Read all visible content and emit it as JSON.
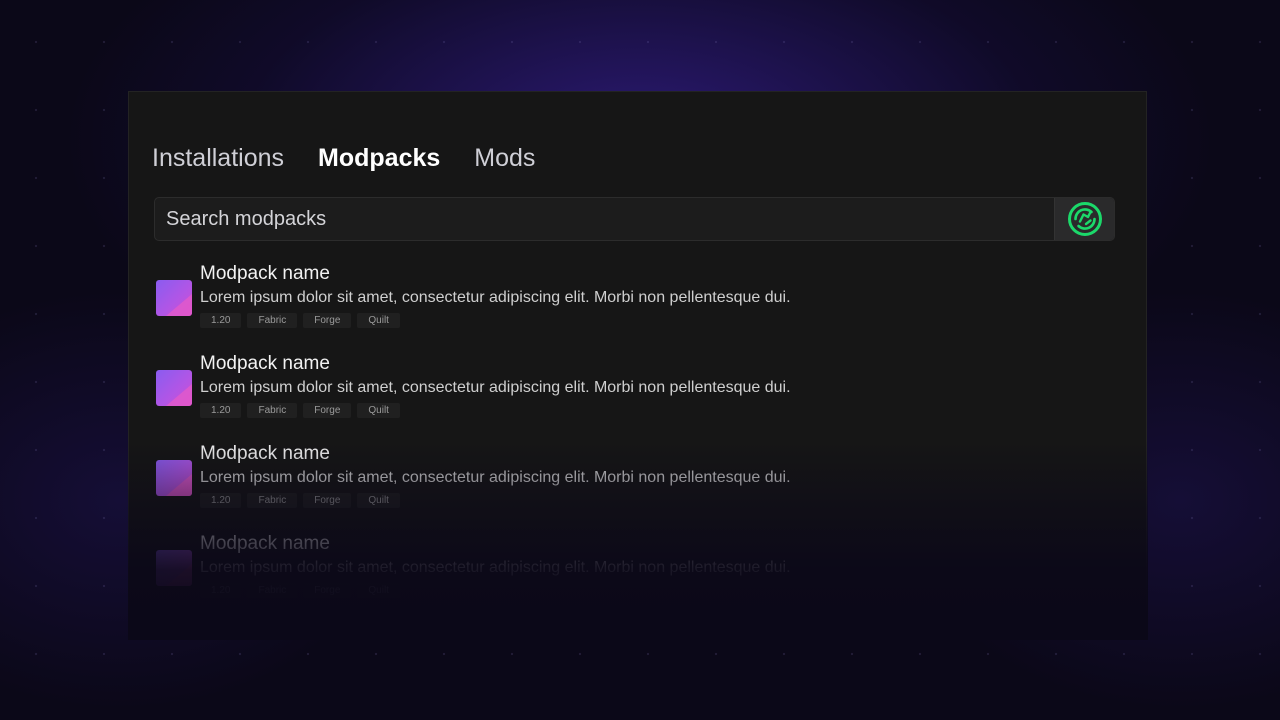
{
  "tabs": [
    {
      "label": "Installations",
      "active": false
    },
    {
      "label": "Modpacks",
      "active": true
    },
    {
      "label": "Mods",
      "active": false
    }
  ],
  "search": {
    "placeholder": "Search modpacks",
    "button_icon": "modrinth-logo-icon",
    "accent_color": "#1bd96a"
  },
  "modpacks": [
    {
      "title": "Modpack name",
      "description": "Lorem ipsum dolor sit amet, consectetur adipiscing elit. Morbi non pellentesque dui.",
      "tags": [
        "1.20",
        "Fabric",
        "Forge",
        "Quilt"
      ]
    },
    {
      "title": "Modpack name",
      "description": "Lorem ipsum dolor sit amet, consectetur adipiscing elit. Morbi non pellentesque dui.",
      "tags": [
        "1.20",
        "Fabric",
        "Forge",
        "Quilt"
      ]
    },
    {
      "title": "Modpack name",
      "description": "Lorem ipsum dolor sit amet, consectetur adipiscing elit. Morbi non pellentesque dui.",
      "tags": [
        "1.20",
        "Fabric",
        "Forge",
        "Quilt"
      ]
    },
    {
      "title": "Modpack name",
      "description": "Lorem ipsum dolor sit amet, consectetur adipiscing elit. Morbi non pellentesque dui.",
      "tags": [
        "1.20",
        "Fabric",
        "Forge",
        "Quilt"
      ]
    }
  ]
}
